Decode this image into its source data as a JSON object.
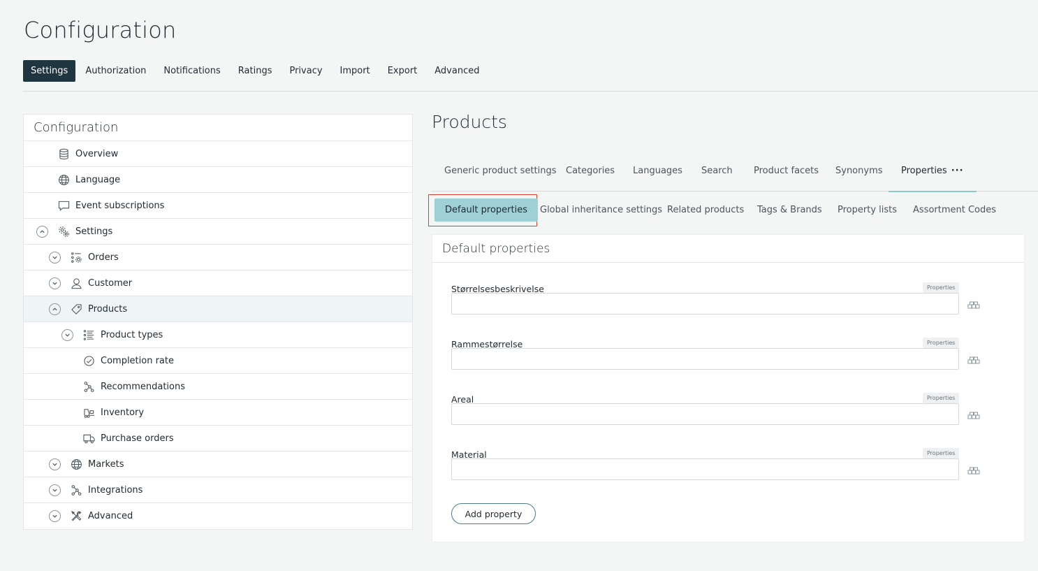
{
  "page": {
    "title": "Configuration"
  },
  "top_tabs": [
    {
      "label": "Settings",
      "active": true
    },
    {
      "label": "Authorization"
    },
    {
      "label": "Notifications"
    },
    {
      "label": "Ratings"
    },
    {
      "label": "Privacy"
    },
    {
      "label": "Import"
    },
    {
      "label": "Export"
    },
    {
      "label": "Advanced"
    }
  ],
  "sidebar": {
    "title": "Configuration",
    "items": [
      {
        "label": "Overview",
        "icon": "database-icon"
      },
      {
        "label": "Language",
        "icon": "globe-icon"
      },
      {
        "label": "Event subscriptions",
        "icon": "speech-bubble-icon"
      },
      {
        "label": "Settings",
        "icon": "gears-icon",
        "toggle": "collapse"
      },
      {
        "label": "Orders",
        "icon": "orders-icon",
        "toggle": "expand"
      },
      {
        "label": "Customer",
        "icon": "user-icon",
        "toggle": "expand"
      },
      {
        "label": "Products",
        "icon": "tag-icon",
        "toggle": "collapse",
        "selected": true
      },
      {
        "label": "Product types",
        "icon": "list-icon",
        "toggle": "expand"
      },
      {
        "label": "Completion rate",
        "icon": "check-circle-icon"
      },
      {
        "label": "Recommendations",
        "icon": "network-icon"
      },
      {
        "label": "Inventory",
        "icon": "forklift-icon"
      },
      {
        "label": "Purchase orders",
        "icon": "truck-icon"
      },
      {
        "label": "Markets",
        "icon": "globe-icon",
        "toggle": "expand"
      },
      {
        "label": "Integrations",
        "icon": "network-icon",
        "toggle": "expand"
      },
      {
        "label": "Advanced",
        "icon": "tools-icon",
        "toggle": "expand"
      }
    ]
  },
  "content": {
    "title": "Products",
    "tabs": [
      {
        "label": "Generic product settings"
      },
      {
        "label": "Categories"
      },
      {
        "label": "Languages"
      },
      {
        "label": "Search"
      },
      {
        "label": "Product facets"
      },
      {
        "label": "Synonyms"
      },
      {
        "label": "Properties",
        "active": true,
        "more": "···"
      }
    ],
    "subtabs": [
      {
        "label": "Default properties",
        "active": true
      },
      {
        "label": "Global inheritance settings"
      },
      {
        "label": "Related products"
      },
      {
        "label": "Tags & Brands"
      },
      {
        "label": "Property lists"
      },
      {
        "label": "Assortment Codes"
      }
    ],
    "panel": {
      "title": "Default properties",
      "fields": [
        {
          "label": "Størrelsesbeskrivelse",
          "badge": "Properties",
          "value": ""
        },
        {
          "label": "Rammestørrelse",
          "badge": "Properties",
          "value": ""
        },
        {
          "label": "Areal",
          "badge": "Properties",
          "value": ""
        },
        {
          "label": "Material",
          "badge": "Properties",
          "value": ""
        }
      ],
      "add_button": "Add property"
    }
  }
}
